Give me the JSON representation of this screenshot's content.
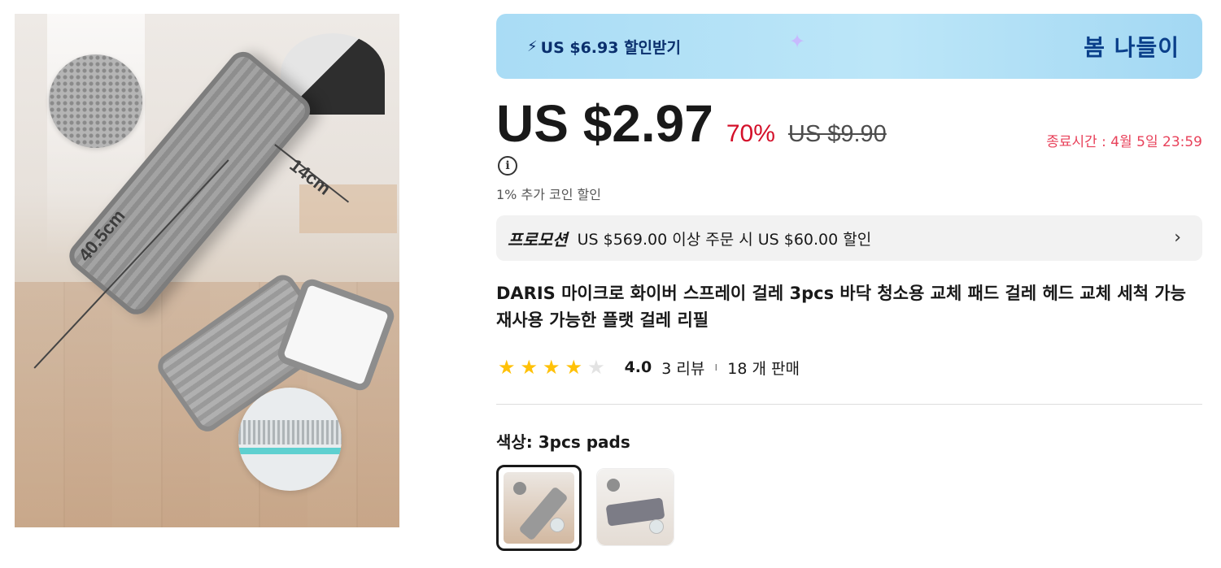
{
  "image": {
    "dimension_long": "40.5cm",
    "dimension_short": "14cm"
  },
  "banner": {
    "discount_text": "US $6.93 할인받기",
    "campaign": "봄 나들이",
    "icon": "bolt-icon",
    "bg_color": "#a9dcf5"
  },
  "price": {
    "current": "US $2.97",
    "discount": "70%",
    "original": "US $9.90",
    "deadline": "종료시간 :  4월 5일 23:59",
    "discount_color": "#d4102a"
  },
  "coin_note": "1% 추가 코인 할인",
  "promotion": {
    "label": "프로모션",
    "text": "US $569.00 이상 주문 시 US $60.00 할인"
  },
  "product": {
    "title": "DARIS 마이크로 화이버 스프레이 걸레 3pcs 바닥 청소용 교체 패드 걸레 헤드 교체 세척 가능 재사용 가능한 플랫 걸레 리필",
    "rating_value": "4.0",
    "stars_filled": 4,
    "stars_total": 5,
    "reviews": "3 리뷰",
    "separator": "ı",
    "sold": "18 개 판매"
  },
  "color": {
    "label": "색상: 3pcs pads",
    "options_selected_index": 0
  }
}
